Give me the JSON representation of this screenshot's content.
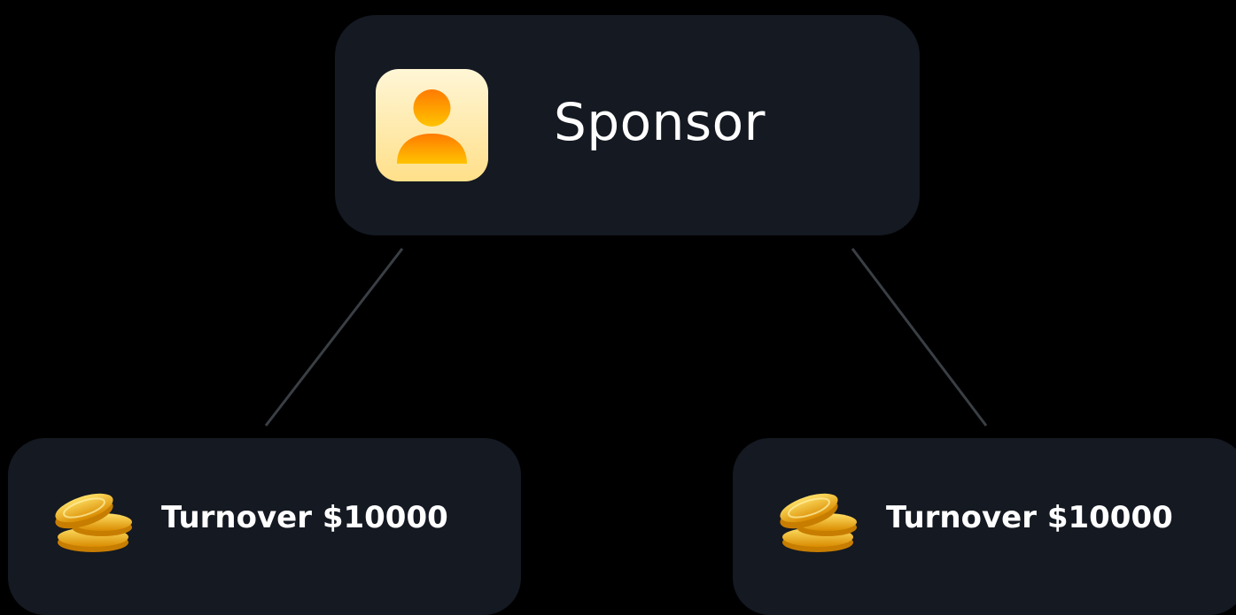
{
  "diagram": {
    "sponsor": {
      "label": "Sponsor",
      "icon": "user-avatar-icon"
    },
    "children": [
      {
        "label": "Turnover $10000",
        "icon": "gold-coins-icon"
      },
      {
        "label": "Turnover $10000",
        "icon": "gold-coins-icon"
      }
    ]
  },
  "colors": {
    "background": "#000000",
    "node_fill": "#141922",
    "text": "#ffffff",
    "connector": "#3a3f45",
    "avatar_bg_top": "#fff6d6",
    "avatar_bg_bottom": "#ffe08a",
    "avatar_figure_top": "#ff7a00",
    "avatar_figure_bottom": "#ffc400",
    "coin_gold": "#f6b400"
  }
}
